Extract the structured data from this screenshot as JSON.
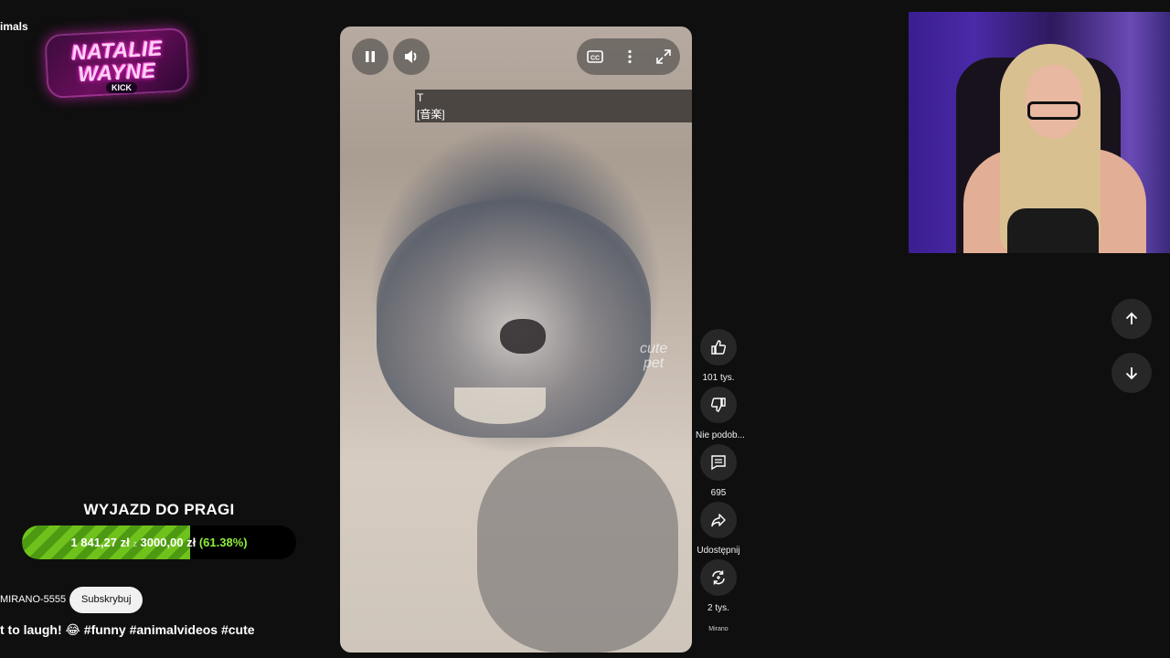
{
  "page": {
    "left_cropped_title": "imals"
  },
  "overlay_logo": {
    "line1": "NATALIE",
    "line2": "WAYNE",
    "tag": "KICK"
  },
  "goal": {
    "title": "WYJAZD DO PRAGI",
    "current": "1 841,27 zł",
    "separator": "z",
    "target": "3000,00 zł",
    "percent_label": "(61.38%)",
    "progress_fraction": 0.6138,
    "fill_color": "#6fc21c"
  },
  "channel": {
    "name": "MIRANO-5555",
    "subscribe_label": "Subskrybuj"
  },
  "video": {
    "caption_text": "t to laugh! 😂",
    "hashtags": "#funny #animalvideos #cute",
    "subtitle_line1": "T",
    "subtitle_line2": "[音楽]",
    "watermark_line1": "cute",
    "watermark_line2": "pet",
    "controls": {
      "pause_icon": "pause-icon",
      "volume_icon": "volume-icon",
      "cc_icon": "cc-icon",
      "more_icon": "more-vert-icon",
      "fullscreen_icon": "fullscreen-icon"
    }
  },
  "actions": {
    "like_label": "101 tys.",
    "dislike_label": "Nie podob...",
    "comments_label": "695",
    "share_label": "Udostępnij",
    "remix_label": "2 tys.",
    "channel_mini_label": "Mirano"
  },
  "navigation": {
    "up_icon": "arrow-up-icon",
    "down_icon": "arrow-down-icon"
  },
  "colors": {
    "background": "#0f0f0f",
    "button_bg": "#272727",
    "accent_green": "#8ef03a"
  }
}
